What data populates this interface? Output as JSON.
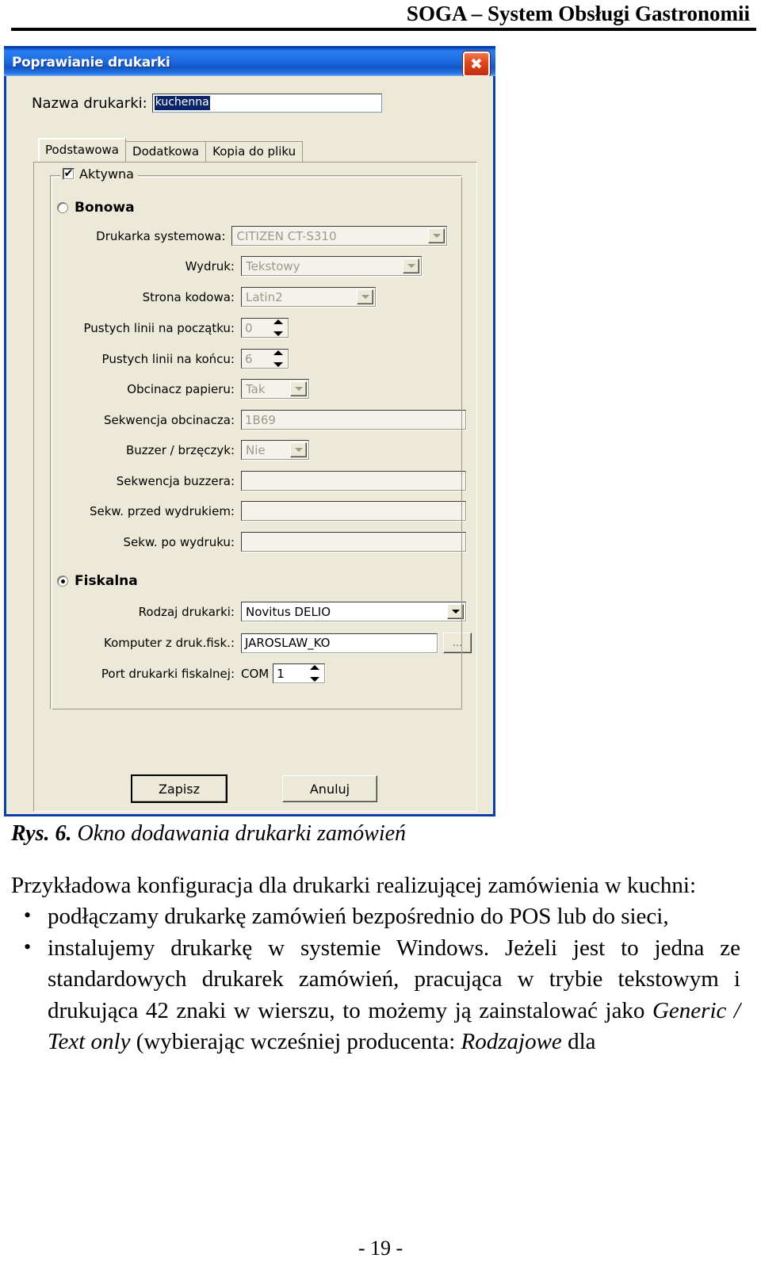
{
  "page": {
    "header_title": "SOGA – System Obsługi Gastronomii",
    "page_number": "- 19 -"
  },
  "dialog": {
    "title": "Poprawianie drukarki",
    "close_icon": "close-icon",
    "name_label": "Nazwa drukarki:",
    "name_value": "kuchenna",
    "tabs": [
      {
        "label": "Podstawowa",
        "active": true
      },
      {
        "label": "Dodatkowa",
        "active": false
      },
      {
        "label": "Kopia do pliku",
        "active": false
      }
    ],
    "group": {
      "legend_label": "Aktywna",
      "legend_checked": "✔"
    },
    "bonowa": {
      "radio_label": "Bonowa",
      "selected": false,
      "fields": [
        {
          "label": "Drukarka systemowa:",
          "value": "CITIZEN CT-S310",
          "type": "combo",
          "disabled": true
        },
        {
          "label": "Wydruk:",
          "value": "Tekstowy",
          "type": "combo",
          "disabled": true
        },
        {
          "label": "Strona kodowa:",
          "value": "Latin2",
          "type": "combo",
          "disabled": true
        },
        {
          "label": "Pustych linii na początku:",
          "value": "0",
          "type": "spinner",
          "disabled": true
        },
        {
          "label": "Pustych linii na końcu:",
          "value": "6",
          "type": "spinner",
          "disabled": true
        },
        {
          "label": "Obcinacz papieru:",
          "value": "Tak",
          "type": "combo",
          "disabled": true
        },
        {
          "label": "Sekwencja obcinacza:",
          "value": "1B69",
          "type": "text",
          "disabled": true
        },
        {
          "label": "Buzzer / brzęczyk:",
          "value": "Nie",
          "type": "combo",
          "disabled": true
        },
        {
          "label": "Sekwencja buzzera:",
          "value": "",
          "type": "text",
          "disabled": true
        },
        {
          "label": "Sekw. przed wydrukiem:",
          "value": "",
          "type": "text",
          "disabled": true
        },
        {
          "label": "Sekw. po wydruku:",
          "value": "",
          "type": "text",
          "disabled": true
        }
      ]
    },
    "fiskalna": {
      "radio_label": "Fiskalna",
      "selected": true,
      "rodzaj_label": "Rodzaj drukarki:",
      "rodzaj_value": "Novitus DELIO",
      "komputer_label": "Komputer z druk.fisk.:",
      "komputer_value": "JAROSLAW_KO",
      "browse_label": "...",
      "port_label": "Port drukarki fiskalnej:",
      "port_prefix": "COM",
      "port_value": "1"
    },
    "buttons": {
      "save": "Zapisz",
      "cancel": "Anuluj"
    },
    "colors": {
      "titlebar_blue": "#1f6ce4",
      "dialog_face": "#ece9d8",
      "close_red": "#e0481f",
      "selection_blue": "#0a246a"
    }
  },
  "document": {
    "figure_caption_number": "Rys. 6.",
    "figure_caption_text": " Okno dodawania drukarki zamówień",
    "intro_paragraph": "Przykładowa konfiguracja dla drukarki realizującej zamówienia w kuchni:",
    "bullets": [
      "podłączamy drukarkę zamówień bezpośrednio do POS lub do sieci,",
      "instalujemy drukarkę w systemie Windows. Jeżeli jest to jedna ze standardowych drukarek zamówień, pracująca w trybie tekstowym i drukująca 42 znaki w wierszu, to możemy ją zainstalować jako ",
      "Generic / Text only",
      " (wybierając wcześniej producenta: ",
      "Rodzajowe",
      " dla"
    ]
  }
}
